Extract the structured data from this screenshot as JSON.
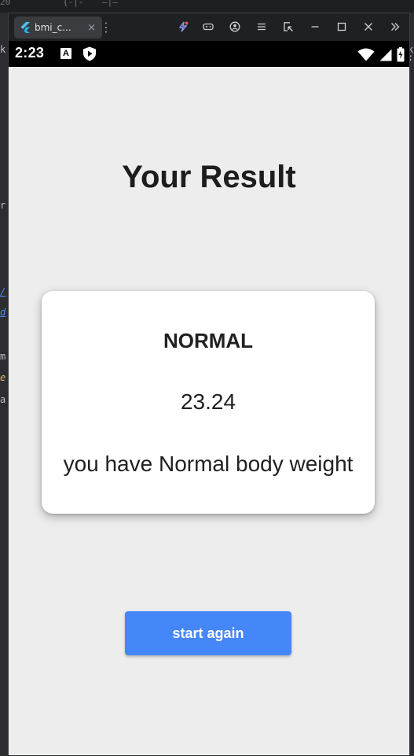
{
  "ide": {
    "top_fragments": [
      "20",
      "{-|-",
      "—|—"
    ],
    "left_fragments": [
      {
        "text": "r",
        "style": "plain"
      },
      {
        "text": "/",
        "style": "link"
      },
      {
        "text": "d",
        "style": "link"
      },
      {
        "text": "m",
        "style": "plain"
      },
      {
        "text": "e",
        "style": "kw"
      },
      {
        "text": "a",
        "style": "plain"
      },
      {
        "text": "k",
        "style": "plain"
      }
    ],
    "right_fragments": [
      "k",
      ":e"
    ]
  },
  "emulator": {
    "tab_label": "bmi_c...",
    "tab_close": "×",
    "tab_menu": "⋮",
    "toolbar_icons": [
      "snapshot-icon",
      "gamepad-icon",
      "account-icon",
      "menu-icon",
      "screenshot-icon",
      "minimize-icon",
      "maximize-icon",
      "close-icon",
      "more-icon"
    ]
  },
  "status_bar": {
    "time": "2:23",
    "a_badge": "A"
  },
  "screen": {
    "title": "Your Result",
    "result": {
      "status": "NORMAL",
      "bmi": "23.24",
      "message": "you have Normal body weight"
    },
    "button_label": "start again"
  },
  "colors": {
    "background": "#ededee",
    "card": "#ffffff",
    "button": "#4586f8",
    "status_bar": "#000000"
  }
}
